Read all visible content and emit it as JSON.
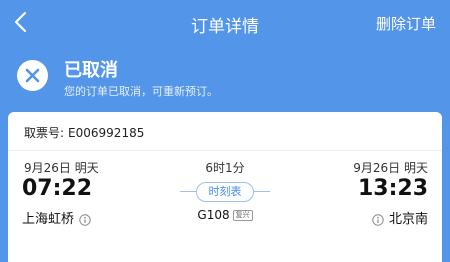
{
  "header": {
    "title": "订单详情",
    "delete_label": "删除订单",
    "back_icon": "chevron-left-icon"
  },
  "status": {
    "icon": "close-circle-icon",
    "title": "已取消",
    "subtitle": "您的订单已取消，可重新预订。"
  },
  "ticket": {
    "label": "取票号:",
    "number": "E006992185"
  },
  "trip": {
    "departure": {
      "date": "9月26日 明天",
      "time": "07:22",
      "station": "上海虹桥"
    },
    "duration": "6时1分",
    "schedule_label": "时刻表",
    "train_number": "G108",
    "train_badge": "复兴",
    "arrival": {
      "date": "9月26日 明天",
      "time": "13:23",
      "station": "北京南"
    }
  },
  "colors": {
    "primary": "#5395e8",
    "card": "#ffffff",
    "accent": "#4a8ee6"
  }
}
